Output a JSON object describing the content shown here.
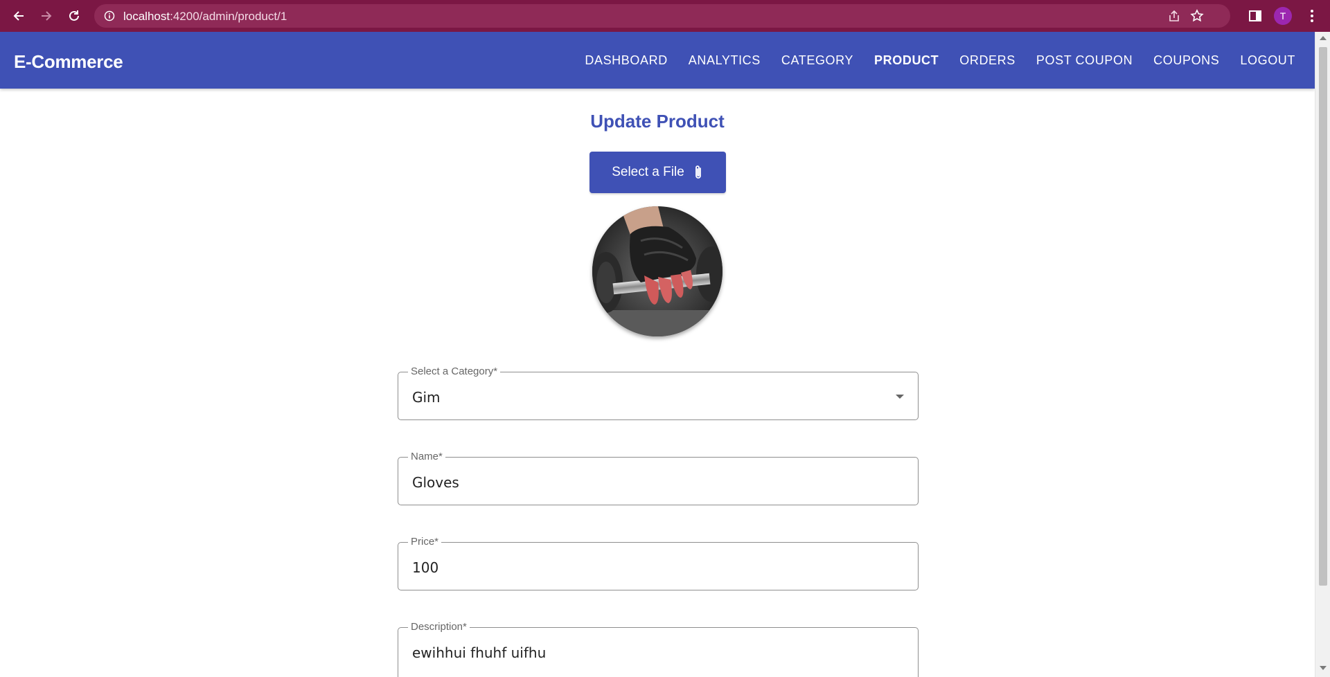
{
  "browser": {
    "url_host": "localhost",
    "url_path": ":4200/admin/product/1",
    "profile_initial": "T"
  },
  "toolbar": {
    "brand": "E-Commerce",
    "nav": [
      "DASHBOARD",
      "ANALYTICS",
      "CATEGORY",
      "PRODUCT",
      "ORDERS",
      "POST COUPON",
      "COUPONS",
      "LOGOUT"
    ],
    "active": "PRODUCT"
  },
  "page": {
    "title": "Update Product",
    "file_button": "Select a File"
  },
  "form": {
    "category_label": "Select a Category*",
    "category_value": "Gim",
    "name_label": "Name*",
    "name_value": "Gloves",
    "price_label": "Price*",
    "price_value": "100",
    "description_label": "Description*",
    "description_value": "ewihhui fhuhf uifhu"
  },
  "colors": {
    "primary": "#3f51b5",
    "browser_frame": "#7b1744"
  }
}
